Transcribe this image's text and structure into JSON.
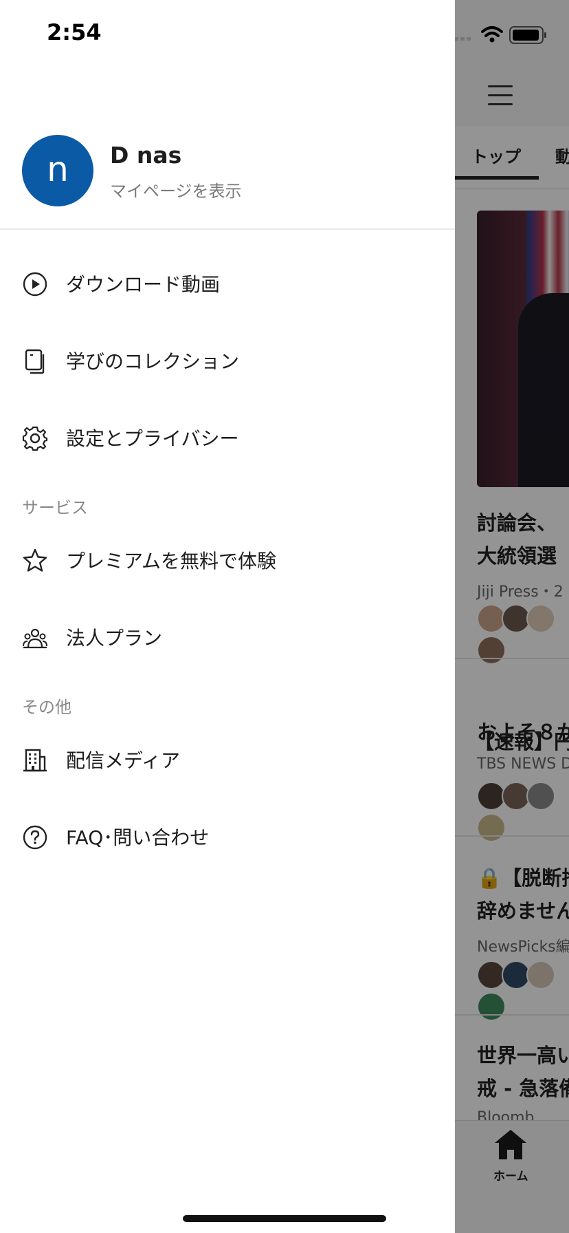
{
  "status_bar": {
    "time": "2:54"
  },
  "profile": {
    "avatar_initial": "n",
    "avatar_color": "#0b5aa6",
    "name": "D nas",
    "subtitle": "マイページを表示"
  },
  "menu": {
    "items": [
      {
        "icon": "play-circle-icon",
        "label": "ダウンロード動画"
      },
      {
        "icon": "collection-icon",
        "label": "学びのコレクション"
      },
      {
        "icon": "gear-icon",
        "label": "設定とプライバシー"
      }
    ],
    "services_header": "サービス",
    "services": [
      {
        "icon": "star-icon",
        "label": "プレミアムを無料で体験"
      },
      {
        "icon": "people-icon",
        "label": "法人プラン"
      }
    ],
    "other_header": "その他",
    "other": [
      {
        "icon": "building-icon",
        "label": "配信メディア"
      },
      {
        "icon": "question-circle-icon",
        "label": "FAQ･問い合わせ"
      }
    ]
  },
  "background": {
    "tabs": [
      "トップ",
      "動"
    ],
    "articles": [
      {
        "title_line1": "討論会、",
        "title_line2": "大統領選",
        "source": "Jiji Press・2"
      },
      {
        "title_line1": "【速報】円相",
        "title_line2": "およそ８か",
        "source": "TBS NEWS D"
      },
      {
        "title_line1": "🔒【脱断捨",
        "title_line2": "辞めません",
        "source": "NewsPicks編"
      },
      {
        "title_line1": "世界一高い",
        "title_line2": "戒 - 急落備",
        "source": "Bloomb"
      }
    ],
    "tabbar_home_label": "ホーム"
  }
}
